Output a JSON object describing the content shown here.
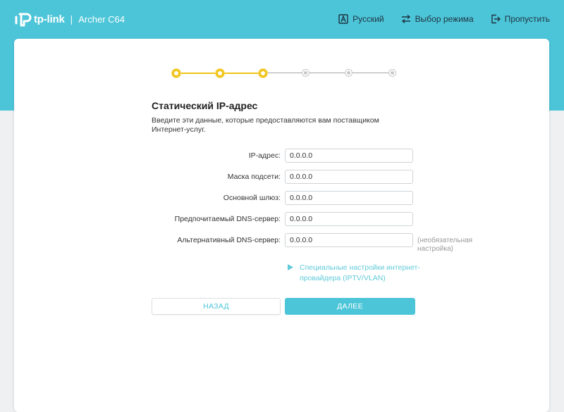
{
  "header": {
    "brand": "tp-link",
    "separator": "|",
    "model": "Archer C64",
    "actions": [
      {
        "label": "Русский",
        "icon": "language-icon"
      },
      {
        "label": "Выбор режима",
        "icon": "mode-switch-icon"
      },
      {
        "label": "Пропустить",
        "icon": "skip-icon"
      }
    ]
  },
  "stepper": {
    "total_steps": 6,
    "completed_steps": 3
  },
  "form": {
    "title": "Статический IP-адрес",
    "description": "Введите эти данные, которые предоставляются вам поставщиком Интернет-услуг.",
    "fields": [
      {
        "label": "IP-адрес:",
        "value": "0.0.0.0"
      },
      {
        "label": "Маска подсети:",
        "value": "0.0.0.0"
      },
      {
        "label": "Основной шлюз:",
        "value": "0.0.0.0"
      },
      {
        "label": "Предпочитаемый DNS-сервер:",
        "value": "0.0.0.0"
      },
      {
        "label": "Альтернативный DNS-сервер:",
        "value": "0.0.0.0"
      }
    ],
    "optional_note": "(необязательная настройка)",
    "advanced_link": "Специальные настройки интернет-провайдера (IPTV/VLAN)",
    "back_button": "НАЗАД",
    "next_button": "ДАЛЕЕ"
  },
  "colors": {
    "accent": "#4cc5d8",
    "progress": "#f0c419",
    "text": "#333333"
  }
}
